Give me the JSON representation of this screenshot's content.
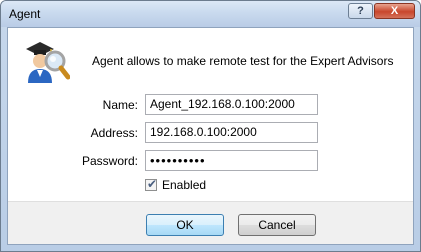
{
  "window": {
    "title": "Agent",
    "help_glyph": "?",
    "close_glyph": "X"
  },
  "header": {
    "icon": "agent-graduate-magnifier-icon",
    "description": "Agent allows to make remote test for the Expert Advisors"
  },
  "form": {
    "name": {
      "label": "Name:",
      "value": "Agent_192.168.0.100:2000"
    },
    "address": {
      "label": "Address:",
      "value": "192.168.0.100:2000"
    },
    "password": {
      "label": "Password:",
      "value": "••••••••••"
    },
    "enabled": {
      "label": "Enabled",
      "checked": true
    }
  },
  "buttons": {
    "ok": "OK",
    "cancel": "Cancel"
  },
  "colors": {
    "title_bar": "#c9daee",
    "close_button": "#c8462c",
    "default_button_border": "#3c7fb1"
  }
}
